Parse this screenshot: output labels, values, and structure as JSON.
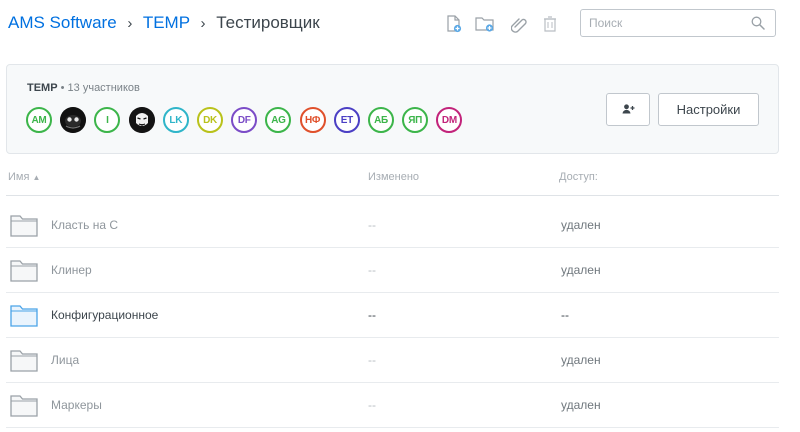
{
  "breadcrumb": {
    "items": [
      "AMS Software",
      "TEMP"
    ],
    "separator": "›",
    "current": "Тестировщик"
  },
  "toolbar": {
    "icons": [
      "new-file-icon",
      "new-folder-icon",
      "attach-link-icon",
      "trash-icon"
    ]
  },
  "search": {
    "placeholder": "Поиск",
    "value": ""
  },
  "team": {
    "name": "TEMP",
    "separator": "•",
    "members_count": "13 участников",
    "avatars": [
      {
        "initials": "AM",
        "color": "#3cb54a"
      },
      {
        "initials": "",
        "kind": "image",
        "color": "#1e1e1e"
      },
      {
        "initials": "I",
        "color": "#3cb54a"
      },
      {
        "initials": "",
        "kind": "image",
        "color": "#1e1e1e"
      },
      {
        "initials": "LK",
        "color": "#2fb5c9"
      },
      {
        "initials": "DK",
        "color": "#b9c21b"
      },
      {
        "initials": "DF",
        "color": "#7b4cc7"
      },
      {
        "initials": "AG",
        "color": "#3cb54a"
      },
      {
        "initials": "НФ",
        "color": "#e0502b"
      },
      {
        "initials": "ET",
        "color": "#4b3fc4"
      },
      {
        "initials": "АБ",
        "color": "#3cb54a"
      },
      {
        "initials": "ЯП",
        "color": "#3cb54a"
      },
      {
        "initials": "DM",
        "color": "#c2237a"
      }
    ],
    "add_member_icon": "add-user-icon",
    "settings_label": "Настройки"
  },
  "table": {
    "columns": {
      "name": "Имя",
      "changed": "Изменено",
      "access": "Доступ:"
    },
    "sort_indicator": "▲",
    "rows": [
      {
        "name": "Класть на С",
        "changed": "--",
        "access": "удален",
        "state": "removed"
      },
      {
        "name": "Клинер",
        "changed": "--",
        "access": "удален",
        "state": "removed"
      },
      {
        "name": "Конфигурационное",
        "changed": "--",
        "access": "--",
        "state": "active"
      },
      {
        "name": "Лица",
        "changed": "--",
        "access": "удален",
        "state": "removed"
      },
      {
        "name": "Маркеры",
        "changed": "--",
        "access": "удален",
        "state": "removed"
      }
    ]
  },
  "colors": {
    "link": "#0070e0",
    "folder_active": "#4aa3e8",
    "folder_removed": "#9aa1a7"
  }
}
